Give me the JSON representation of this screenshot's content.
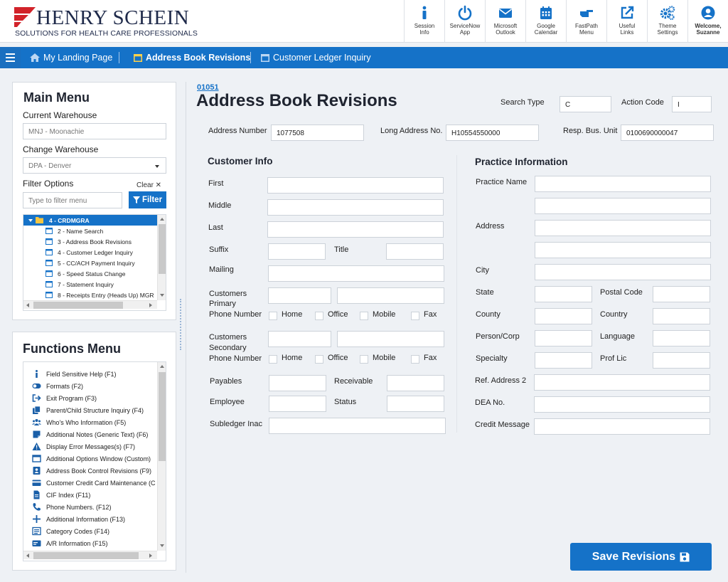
{
  "brand": {
    "name": "HENRY SCHEIN",
    "registered": "®",
    "tagline": "SOLUTIONS FOR HEALTH CARE PROFESSIONALS",
    "colors": {
      "red": "#d2232a",
      "navy": "#1f2a4a"
    }
  },
  "toplinks": [
    {
      "label": "Session\nInfo",
      "icon": "info-icon"
    },
    {
      "label": "ServiceNow\nApp",
      "icon": "power-icon"
    },
    {
      "label": "Microsoft\nOutlook",
      "icon": "envelope-icon"
    },
    {
      "label": "Google\nCalendar",
      "icon": "calendar-icon"
    },
    {
      "label": "FastPath\nMenu",
      "icon": "pointing-hand-icon"
    },
    {
      "label": "Useful\nLinks",
      "icon": "external-link-icon"
    },
    {
      "label": "Theme\nSettings",
      "icon": "gears-icon"
    },
    {
      "label": "Welcome,\nSuzanne",
      "icon": "user-circle-icon"
    }
  ],
  "navbar": {
    "accent": "#1572c8",
    "tabs": [
      {
        "label": "My Landing Page",
        "icon": "home-icon"
      },
      {
        "label": "Address Book Revisions",
        "icon": "window-icon",
        "active": true
      },
      {
        "label": "Customer Ledger Inquiry",
        "icon": "window-icon"
      }
    ]
  },
  "main_menu": {
    "title": "Main Menu",
    "current_warehouse_label": "Current Warehouse",
    "current_warehouse_value": "MNJ - Moonachie",
    "change_warehouse_label": "Change Warehouse",
    "change_warehouse_value": "DPA - Denver",
    "filter_label": "Filter Options",
    "clear_label": "Clear",
    "filter_placeholder": "Type to filter menu",
    "filter_button": "Filter",
    "tree_root": "4 - CRDMGRA",
    "tree_items": [
      "2 - Name Search",
      "3 - Address Book Revisions",
      "4 - Customer Ledger Inquiry",
      "5 - CC/ACH Payment Inquiry",
      "6 - Speed Status Change",
      "7 - Statement Inquiry",
      "8 - Receipts Entry (Heads Up) MGR"
    ]
  },
  "functions_menu": {
    "title": "Functions Menu",
    "items": [
      {
        "label": "Field Sensitive Help (F1)",
        "icon": "info-icon"
      },
      {
        "label": "Formats (F2)",
        "icon": "toggle-icon"
      },
      {
        "label": "Exit Program (F3)",
        "icon": "exit-icon"
      },
      {
        "label": "Parent/Child Structure Inquiry (F4)",
        "icon": "copy-icon"
      },
      {
        "label": "Who's Who Information (F5)",
        "icon": "users-icon"
      },
      {
        "label": "Additional Notes (Generic Text) (F6)",
        "icon": "note-icon"
      },
      {
        "label": "Display Error Messages(s) (F7)",
        "icon": "warning-icon"
      },
      {
        "label": "Additional Options Window (Custom)",
        "icon": "window-icon"
      },
      {
        "label": "Address Book Control Revisions (F9)",
        "icon": "contact-card-icon"
      },
      {
        "label": "Customer Credit Card Maintenance (C",
        "icon": "credit-card-icon"
      },
      {
        "label": "CIF Index (F11)",
        "icon": "document-icon"
      },
      {
        "label": "Phone Numbers. (F12)",
        "icon": "phone-icon"
      },
      {
        "label": "Additional Information (F13)",
        "icon": "plus-icon"
      },
      {
        "label": "Category Codes (F14)",
        "icon": "list-icon"
      },
      {
        "label": "A/R Information (F15)",
        "icon": "ar-card-icon"
      }
    ]
  },
  "page": {
    "program_id": "01051",
    "title": "Address Book Revisions",
    "search_type_label": "Search Type",
    "search_type_value": "C",
    "action_code_label": "Action Code",
    "action_code_value": "I",
    "address_number_label": "Address Number",
    "address_number_value": "1077508",
    "long_address_label": "Long Address No.",
    "long_address_value": "H10554550000",
    "resp_bus_unit_label": "Resp. Bus. Unit",
    "resp_bus_unit_value": "0100690000047"
  },
  "customer_info": {
    "title": "Customer Info",
    "first": "First",
    "middle": "Middle",
    "last": "Last",
    "suffix": "Suffix",
    "title_label": "Title",
    "mailing": "Mailing",
    "primary_line1": "Customers",
    "primary_line2": "Primary",
    "primary_line3": "Phone Number",
    "secondary_line1": "Customers",
    "secondary_line2": "Secondary",
    "secondary_line3": "Phone Number",
    "home": "Home",
    "office": "Office",
    "mobile": "Mobile",
    "fax": "Fax",
    "payables": "Payables",
    "receivable": "Receivable",
    "employee": "Employee",
    "status": "Status",
    "subledger": "Subledger Inac"
  },
  "practice_info": {
    "title": "Practice Information",
    "practice_name": "Practice Name",
    "address": "Address",
    "city": "City",
    "state": "State",
    "postal_code": "Postal Code",
    "county": "County",
    "country": "Country",
    "person_corp": "Person/Corp",
    "language": "Language",
    "specialty": "Specialty",
    "prof_lic": "Prof Lic",
    "ref_address": "Ref. Address 2",
    "dea": "DEA No.",
    "credit_message": "Credit Message"
  },
  "save_button": "Save Revisions"
}
